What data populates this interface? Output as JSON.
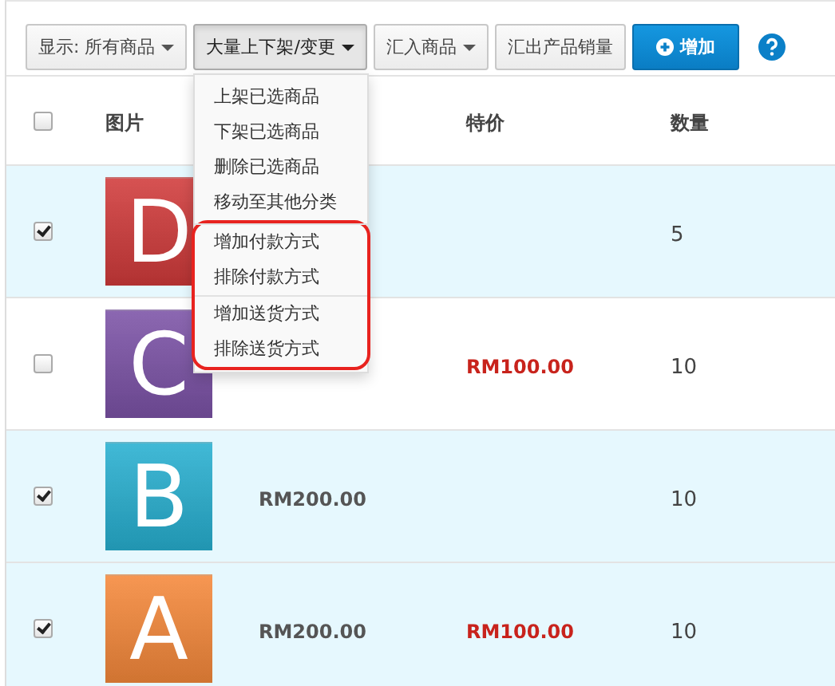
{
  "toolbar": [
    {
      "label": "显示: 所有商品",
      "kind": "default",
      "caret": true,
      "open": false
    },
    {
      "label": "大量上下架/变更",
      "kind": "default",
      "caret": true,
      "open": true
    },
    {
      "label": "汇入商品",
      "kind": "default",
      "caret": true,
      "open": false
    },
    {
      "label": "汇出产品销量",
      "kind": "default",
      "caret": false,
      "open": false
    },
    {
      "label": "增加",
      "kind": "primary",
      "caret": false,
      "open": false
    }
  ],
  "menu": {
    "sections": [
      {
        "highlighted": false,
        "items": [
          "上架已选商品",
          "下架已选商品",
          "删除已选商品",
          "移动至其他分类"
        ]
      },
      {
        "highlighted": true,
        "items": [
          "增加付款方式",
          "排除付款方式"
        ]
      },
      {
        "highlighted": true,
        "items": [
          "增加送货方式",
          "排除送货方式"
        ]
      }
    ]
  },
  "table": {
    "header_checked": false,
    "columns": [
      "图片",
      "",
      "特价",
      "数量"
    ],
    "rows": [
      {
        "selected": true,
        "tile": {
          "letter": "D",
          "color": "#d03a3a"
        },
        "price": "",
        "special": "",
        "quantity": "5"
      },
      {
        "selected": false,
        "tile": {
          "letter": "C",
          "color": "#7b52a6"
        },
        "price": "",
        "special": "RM100.00",
        "quantity": "10"
      },
      {
        "selected": true,
        "tile": {
          "letter": "B",
          "color": "#27afd0"
        },
        "price": "RM200.00",
        "special": "",
        "quantity": "10"
      },
      {
        "selected": true,
        "tile": {
          "letter": "A",
          "color": "#f5883a"
        },
        "price": "RM200.00",
        "special": "RM100.00",
        "quantity": "10"
      }
    ]
  }
}
